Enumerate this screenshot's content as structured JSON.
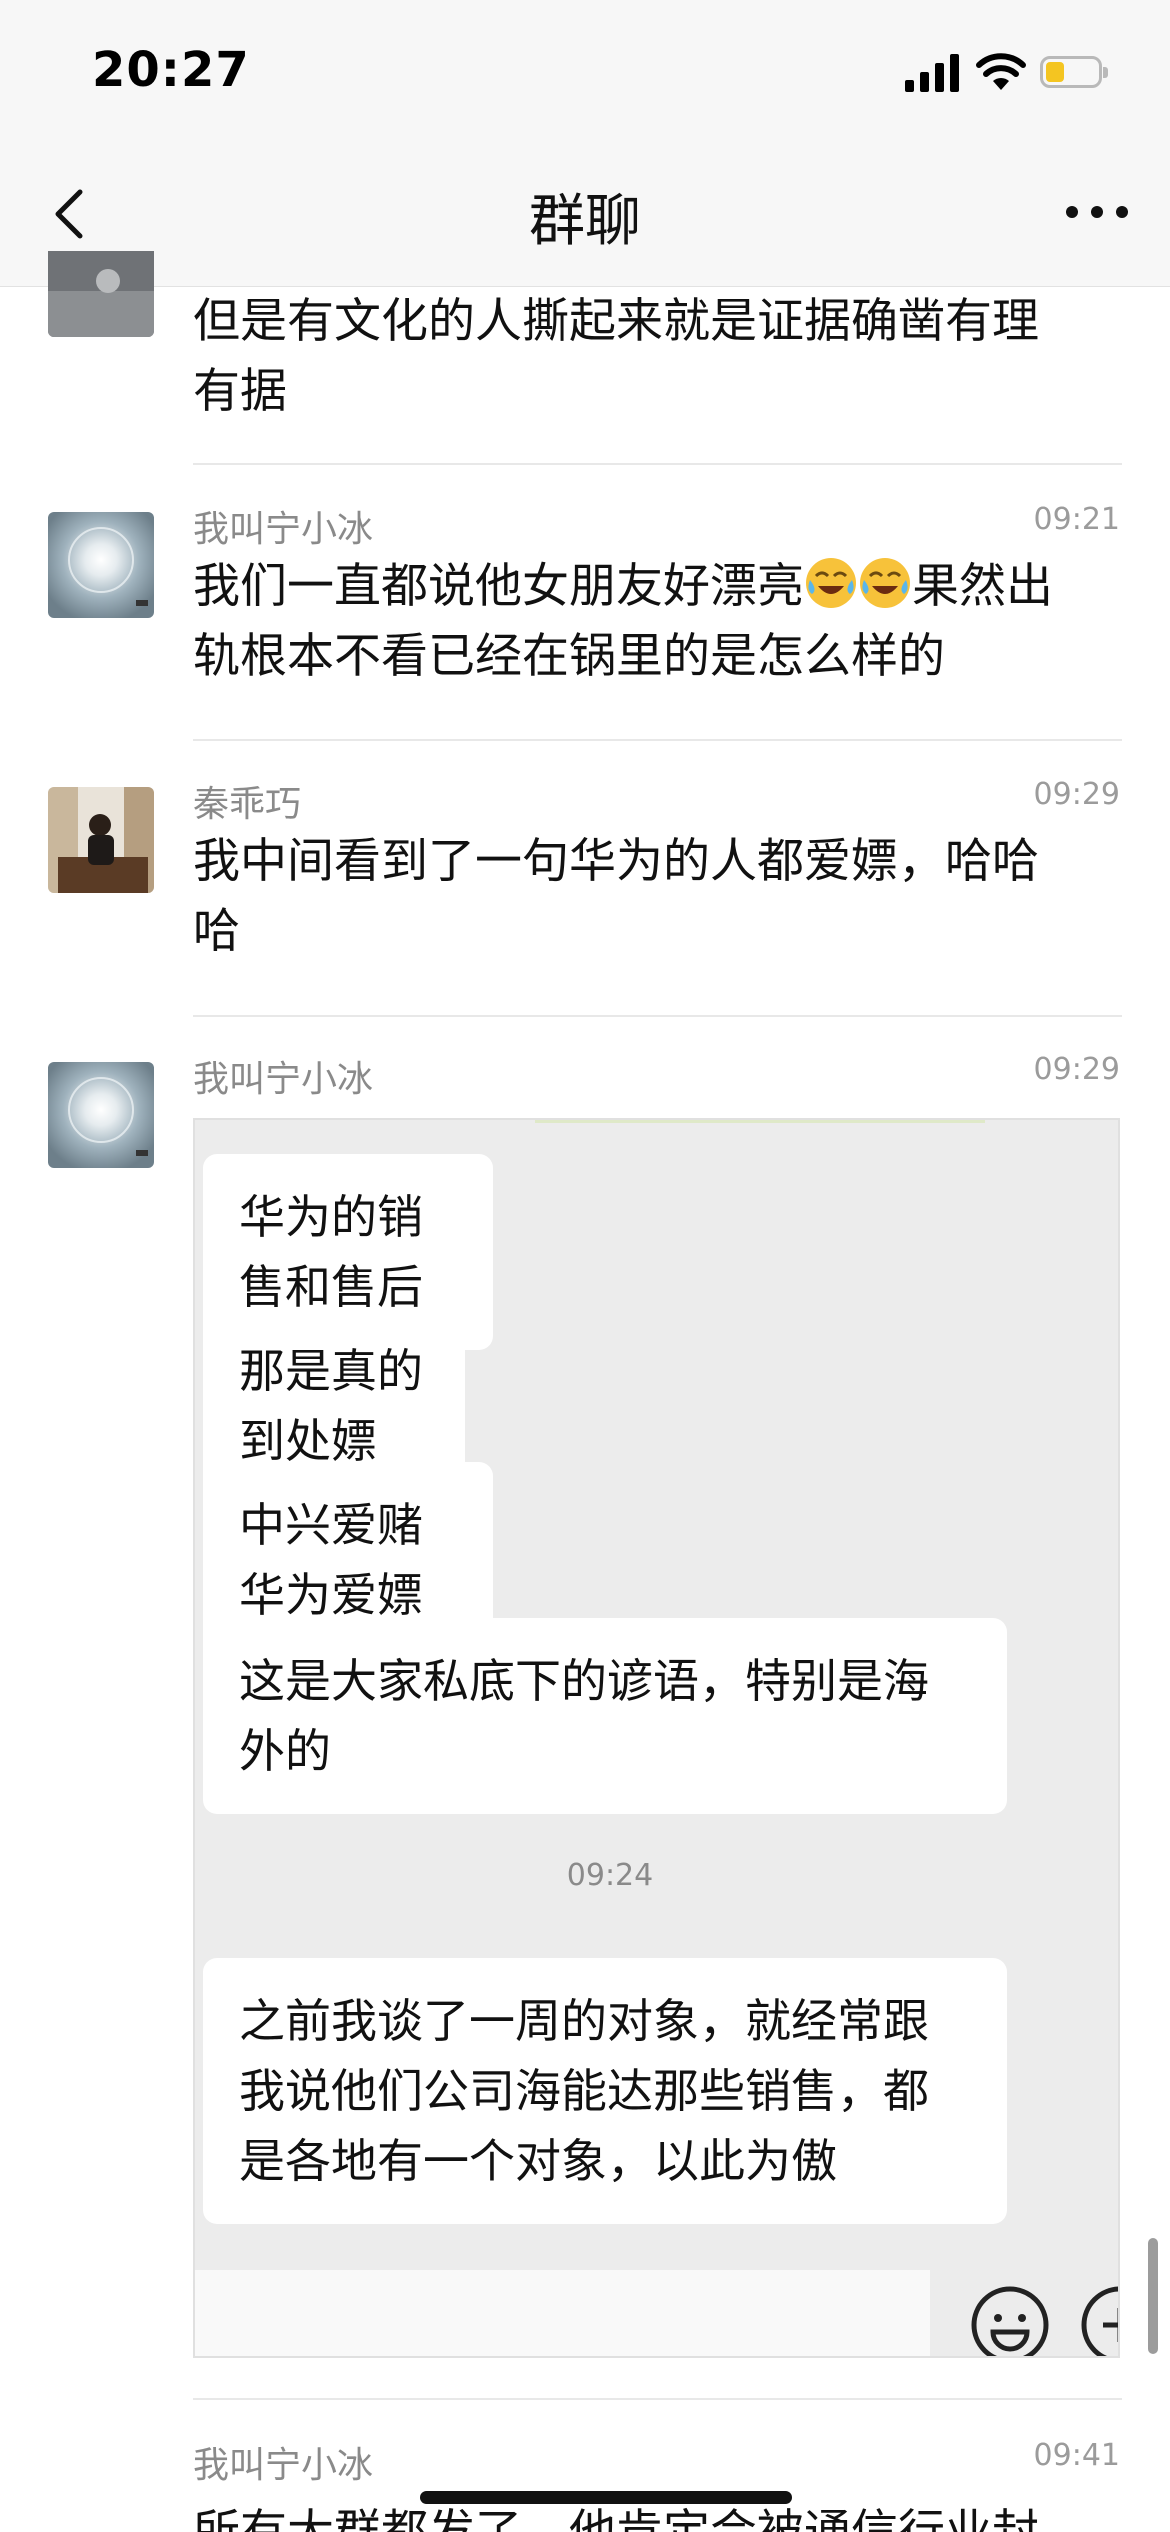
{
  "status_bar": {
    "time": "20:27",
    "battery_level": 0.35,
    "battery_color": "#f4c521"
  },
  "nav": {
    "title": "群聊",
    "back_icon": "chevron-left-icon",
    "more_icon": "more-dots-icon"
  },
  "messages": [
    {
      "sender": "",
      "time": "",
      "text": "但是有文化的人撕起来就是证据确凿有理有据",
      "line1": "但是有文化的人撕起来就是证据确凿有理",
      "line2": "有据"
    },
    {
      "sender": "我叫宁小冰",
      "time": "09:21",
      "line1a": "我们一直都说他女朋友好漂亮",
      "emoji": "crying-laughing-emoji",
      "line1b": "果然出",
      "line2": "轨根本不看已经在锅里的是怎么样的"
    },
    {
      "sender": "秦乖巧",
      "time": "09:29",
      "line1": "我中间看到了一句华为的人都爱嫖，哈哈",
      "line2": "哈"
    },
    {
      "sender": "我叫宁小冰",
      "time": "09:29",
      "image": {
        "bubbles": [
          {
            "line1": "华为的销售和售后"
          },
          {
            "line1": "那是真的到处嫖"
          },
          {
            "line1": "中兴爱赌华为爱嫖"
          },
          {
            "line1": "这是大家私底下的谚语，特别是海",
            "line2": "外的"
          },
          {
            "line1": "之前我谈了一周的对象，就经常跟",
            "line2": "我说他们公司海能达那些销售，都",
            "line3": "是各地有一个对象，以此为傲"
          }
        ],
        "time": "09:24"
      }
    },
    {
      "sender": "我叫宁小冰",
      "time": "09:41",
      "partial_text": "所有大群都发了，他肯定会被通信行业封"
    }
  ]
}
